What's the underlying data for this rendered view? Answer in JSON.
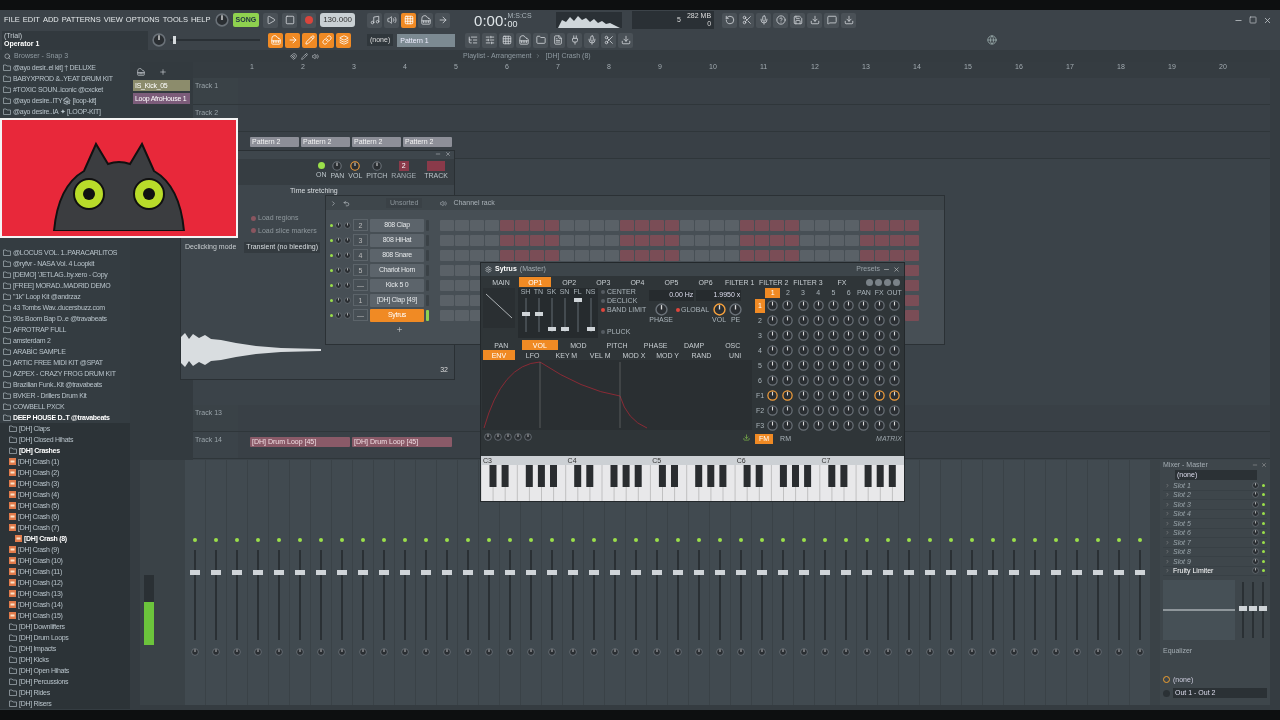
{
  "menu": [
    "FILE",
    "EDIT",
    "ADD",
    "PATTERNS",
    "VIEW",
    "OPTIONS",
    "TOOLS",
    "HELP"
  ],
  "transport": {
    "mode_label": "SONG",
    "song_mode": true,
    "pitch_slider": {
      "level": 0.03
    },
    "tempo": "130.000",
    "time": "0:00:",
    "time_small": "00",
    "time_unit": "M:S:CS",
    "cpu": "5",
    "memory": "282 MB",
    "voices": "0"
  },
  "hint": {
    "title": "(Trial)",
    "text": "Operator 1"
  },
  "pattern": {
    "selector": "(none)",
    "name": "Pattern 1"
  },
  "browser": {
    "title": "Browser - Snap 3",
    "items_top": [
      {
        "name": "@ayo desir..el kit] † DELUXE",
        "kind": "folder"
      },
      {
        "name": "BABYXPROD &..YEAT DRUM KIT",
        "kind": "folder"
      },
      {
        "name": "#TOXIC SOUN..iconic @cxcket",
        "kind": "folder"
      },
      {
        "name": "@ayo desire..ITY🏚 [loop-kit]",
        "kind": "folder"
      },
      {
        "name": "@ayo desire..IA ✦ [LOOP-KIT]",
        "kind": "folder"
      }
    ],
    "items": [
      {
        "name": "@LOCUS VOL. 1..PARACARLITOS",
        "kind": "folder"
      },
      {
        "name": "@ryfvr - NASA Vol. 4 Loopkit",
        "kind": "folder"
      },
      {
        "name": "[DEMO] 'JETLAG..by.xero - Copy",
        "kind": "folder"
      },
      {
        "name": "[FREE] MORAD..MADRID DEMO",
        "kind": "folder"
      },
      {
        "name": "\"1k\" Loop Kit @andrzaz",
        "kind": "folder"
      },
      {
        "name": "43 Tombs Wav..ducersbuzz.com",
        "kind": "folder"
      },
      {
        "name": "90s Boom Bap D..e @travabeats",
        "kind": "folder"
      },
      {
        "name": "AFROTRAP FULL",
        "kind": "folder"
      },
      {
        "name": "amsterdam 2",
        "kind": "folder"
      },
      {
        "name": "ARABİC SAMPLE",
        "kind": "folder"
      },
      {
        "name": "ARTIC FREE MIDI KIT @SPAT",
        "kind": "folder"
      },
      {
        "name": "AZPEX - CRAZY FROG DRUM KIT",
        "kind": "folder"
      },
      {
        "name": "Brazilian Funk..Kit @travabeats",
        "kind": "folder"
      },
      {
        "name": "BVKER - Drillers Drum Kit",
        "kind": "folder"
      },
      {
        "name": "COWBELL PXCK",
        "kind": "folder"
      },
      {
        "name": "DEEP HOUSE D..T @travabeats",
        "kind": "folder",
        "children": [
          {
            "name": "[DH] Claps",
            "kind": "folder"
          },
          {
            "name": "[DH] Closed Hihats",
            "kind": "folder"
          },
          {
            "name": "[DH] Crashes",
            "kind": "folder",
            "children": [
              {
                "name": "[DH] Crash (1)",
                "kind": "file",
                "selected": false
              },
              {
                "name": "[DH] Crash (2)",
                "kind": "file",
                "selected": false
              },
              {
                "name": "[DH] Crash (3)",
                "kind": "file",
                "selected": false
              },
              {
                "name": "[DH] Crash (4)",
                "kind": "file",
                "selected": false
              },
              {
                "name": "[DH] Crash (5)",
                "kind": "file",
                "selected": false
              },
              {
                "name": "[DH] Crash (6)",
                "kind": "file",
                "selected": false
              },
              {
                "name": "[DH] Crash (7)",
                "kind": "file",
                "selected": false
              },
              {
                "name": "[DH] Crash (8)",
                "kind": "file",
                "selected": true
              },
              {
                "name": "[DH] Crash (9)",
                "kind": "file",
                "selected": false
              },
              {
                "name": "[DH] Crash (10)",
                "kind": "file",
                "selected": false
              },
              {
                "name": "[DH] Crash (11)",
                "kind": "file",
                "selected": false
              },
              {
                "name": "[DH] Crash (12)",
                "kind": "file",
                "selected": false
              },
              {
                "name": "[DH] Crash (13)",
                "kind": "file",
                "selected": false
              },
              {
                "name": "[DH] Crash (14)",
                "kind": "file",
                "selected": false
              },
              {
                "name": "[DH] Crash (15)",
                "kind": "file",
                "selected": false
              }
            ]
          },
          {
            "name": "[DH] Downlifters",
            "kind": "folder"
          },
          {
            "name": "[DH] Drum Loops",
            "kind": "folder"
          },
          {
            "name": "[DH] Impacts",
            "kind": "folder"
          },
          {
            "name": "[DH] Kicks",
            "kind": "folder"
          },
          {
            "name": "[DH] Open Hihats",
            "kind": "folder"
          },
          {
            "name": "[DH] Percussions",
            "kind": "folder"
          },
          {
            "name": "[DH] Rides",
            "kind": "folder"
          },
          {
            "name": "[DH] Risers",
            "kind": "folder"
          }
        ]
      }
    ]
  },
  "playlist": {
    "title": "Playlist - Arrangement",
    "path": "[DH] Crash (8)",
    "picker": [
      {
        "name": "IS_Kick_05",
        "color": "#8c8c6c"
      },
      {
        "name": "Loop AfroHouse 1",
        "color": "#7c5c7a"
      }
    ],
    "bars": [
      "1",
      "2",
      "3",
      "4",
      "5",
      "6",
      "7",
      "8",
      "9",
      "10",
      "11",
      "12",
      "13",
      "14",
      "15",
      "16",
      "17",
      "18",
      "19",
      "20"
    ],
    "tracks_top": [
      {
        "name": "Track 1"
      },
      {
        "name": "Track 2"
      },
      {
        "clips": [
          {
            "name": "Pattern 2",
            "kind": "pattern"
          },
          {
            "name": "Pattern 2",
            "kind": "pattern"
          },
          {
            "name": "Pattern 2",
            "kind": "pattern"
          },
          {
            "name": "Pattern 2",
            "kind": "pattern"
          }
        ]
      }
    ],
    "tracks_bottom": [
      {
        "name": "Track 13"
      },
      {
        "name": "Track 14",
        "clips": [
          {
            "name": "[DH] Drum Loop [45]",
            "kind": "audio"
          },
          {
            "name": "[DH] Drum Loop [45]",
            "kind": "audio"
          }
        ]
      }
    ]
  },
  "sampler": {
    "knobs": [
      "ON",
      "PAN",
      "VOL",
      "PITCH"
    ],
    "range_value": "2",
    "range_label": "RANGE",
    "track_label": "TRACK",
    "stretch_title": "Time stretching",
    "options": [
      {
        "label": "Load regions",
        "checked": false
      },
      {
        "label": "Load slice markers",
        "checked": false
      }
    ],
    "declick_label": "Declicking mode",
    "declick_value": "Transient (no bleeding)",
    "zoom": "32"
  },
  "channel_rack": {
    "title": "Channel rack",
    "filter": "Unsorted",
    "channels": [
      {
        "number": "2",
        "name": "808 Clap",
        "selected": false
      },
      {
        "number": "3",
        "name": "808 HiHat",
        "selected": false
      },
      {
        "number": "4",
        "name": "808 Snare",
        "selected": false
      },
      {
        "number": "5",
        "name": "Chariot Horn",
        "selected": false
      },
      {
        "number": "—",
        "name": "Kick 5 0",
        "selected": false
      },
      {
        "number": "1",
        "name": "[DH] Clap [49]",
        "selected": false
      },
      {
        "number": "—",
        "name": "Sytrus",
        "selected": true
      }
    ]
  },
  "sytrus": {
    "title": "Sytrus",
    "subtitle": "(Master)",
    "presets": "Presets",
    "tabs": [
      {
        "label": "MAIN",
        "selected": false
      },
      {
        "label": "OP1",
        "selected": true
      },
      {
        "label": "OP2",
        "selected": false
      },
      {
        "label": "OP3",
        "selected": false
      },
      {
        "label": "OP4",
        "selected": false
      },
      {
        "label": "OP5",
        "selected": false
      },
      {
        "label": "OP6",
        "selected": false
      },
      {
        "label": "FILTER 1",
        "selected": false
      },
      {
        "label": "FILTER 2",
        "selected": false
      },
      {
        "label": "FILTER 3",
        "selected": false
      },
      {
        "label": "FX",
        "selected": false
      }
    ],
    "sliders": [
      {
        "label": "SH",
        "level": 0.52
      },
      {
        "label": "TN",
        "level": 0.52
      },
      {
        "label": "SK",
        "level": 0.05
      },
      {
        "label": "SN",
        "level": 0.05
      },
      {
        "label": "FL",
        "level": 1
      },
      {
        "label": "NS",
        "level": 0.05
      }
    ],
    "options": [
      {
        "label": "CENTER",
        "checked": false
      },
      {
        "label": "DECLICK",
        "checked": false
      },
      {
        "label": "BAND LIMIT",
        "checked": true
      }
    ],
    "pluck": {
      "label": "PLUCK",
      "checked": false
    },
    "frequency": "0.00 Hz",
    "ratio": "1.9950 x",
    "phase_label": "PHASE",
    "global": {
      "label": "GLOBAL",
      "checked": true
    },
    "vol_label": "VOL",
    "pe_label": "PE",
    "mod_tabs": [
      {
        "label": "PAN",
        "selected": false
      },
      {
        "label": "VOL",
        "selected": true
      },
      {
        "label": "MOD",
        "selected": false
      },
      {
        "label": "PITCH",
        "selected": false
      },
      {
        "label": "PHASE",
        "selected": false
      },
      {
        "label": "DAMP",
        "selected": false
      },
      {
        "label": "OSC",
        "selected": false
      }
    ],
    "env_tabs": [
      {
        "label": "ENV",
        "selected": true
      },
      {
        "label": "LFO",
        "selected": false
      },
      {
        "label": "KEY M",
        "selected": false
      },
      {
        "label": "VEL M",
        "selected": false
      },
      {
        "label": "MOD X",
        "selected": false
      },
      {
        "label": "MOD Y",
        "selected": false
      },
      {
        "label": "RAND",
        "selected": false
      },
      {
        "label": "UNI",
        "selected": false
      }
    ],
    "matrix": {
      "columns": [
        {
          "label": "1",
          "selected": true
        },
        {
          "label": "2",
          "selected": false
        },
        {
          "label": "3",
          "selected": false
        },
        {
          "label": "4",
          "selected": false
        },
        {
          "label": "5",
          "selected": false
        },
        {
          "label": "6",
          "selected": false
        },
        {
          "label": "PAN",
          "selected": false
        },
        {
          "label": "FX",
          "selected": false
        },
        {
          "label": "OUT",
          "selected": false
        }
      ],
      "rows": [
        {
          "label": "1",
          "selected": true
        },
        {
          "label": "2",
          "selected": false
        },
        {
          "label": "3",
          "selected": false
        },
        {
          "label": "4",
          "selected": false
        },
        {
          "label": "5",
          "selected": false
        },
        {
          "label": "6",
          "selected": false
        },
        {
          "label": "F1",
          "selected": false,
          "highlighted": [
            true,
            true,
            false,
            false,
            false,
            false,
            false,
            true,
            true
          ]
        },
        {
          "label": "F2",
          "selected": false
        },
        {
          "label": "F3",
          "selected": false
        }
      ]
    },
    "modes": [
      {
        "label": "FM",
        "selected": true
      },
      {
        "label": "RM",
        "selected": false
      }
    ],
    "matrix_label": "MATRIX",
    "octaves": [
      "C3",
      "C4",
      "C5",
      "C6",
      "C7"
    ]
  },
  "mixer": {
    "master_meter": {
      "level": 0.62
    },
    "panel": {
      "title": "Mixer - Master",
      "preset": "(none)",
      "slots": [
        {
          "name": "Slot 1",
          "loaded": false
        },
        {
          "name": "Slot 2",
          "loaded": false
        },
        {
          "name": "Slot 3",
          "loaded": false
        },
        {
          "name": "Slot 4",
          "loaded": false
        },
        {
          "name": "Slot 5",
          "loaded": false
        },
        {
          "name": "Slot 6",
          "loaded": false
        },
        {
          "name": "Slot 7",
          "loaded": false
        },
        {
          "name": "Slot 8",
          "loaded": false
        },
        {
          "name": "Slot 9",
          "loaded": false
        },
        {
          "name": "Fruity Limiter",
          "loaded": true
        }
      ],
      "eq_label": "Equalizer",
      "input": "(none)",
      "output": "Out 1 - Out 2"
    }
  }
}
